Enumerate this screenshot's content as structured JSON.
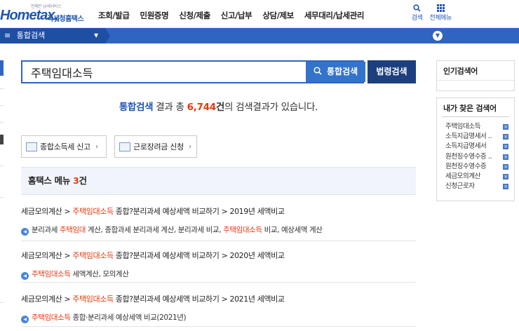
{
  "header": {
    "logo_tagline": "언제든 납세서비스",
    "logo_text": "Hometax,",
    "logo_sub": "국세청홈택스",
    "nav": [
      "조회/발급",
      "민원증명",
      "신청/제출",
      "신고/납부",
      "상담/제보",
      "세무대리/납세관리"
    ],
    "search_label": "검색",
    "all_menu_label": "전체메뉴"
  },
  "menubar": {
    "current": "통합검색"
  },
  "search": {
    "query": "주택임대소득",
    "search_button": "통합검색",
    "law_button": "법령검색"
  },
  "summary": {
    "prefix": "통합검색",
    "text1": "결과 총",
    "count": "6,744",
    "unit": "건",
    "text2": "의 검색결과가 있습니다."
  },
  "quick_links": [
    {
      "label": "종합소득세 신고"
    },
    {
      "label": "근로장려금 신청"
    }
  ],
  "menu_section": {
    "title": "홈택스 메뉴",
    "count": "3",
    "unit": "건"
  },
  "results": [
    {
      "path_prefix": "세금모의계산 > ",
      "path_hl": "주택임대소득",
      "path_suffix": " 종합?분리과세 예상세액 비교하기 > 2019년 세액비교",
      "desc": [
        {
          "t": "분리과세 ",
          "hl": false
        },
        {
          "t": "주택임대",
          "hl": true
        },
        {
          "t": " 계산, 종합과세 분리과세 계산, 분리과세 비교, ",
          "hl": false
        },
        {
          "t": "주택임대소득",
          "hl": true
        },
        {
          "t": " 비교, 예상세액 계산",
          "hl": false
        }
      ]
    },
    {
      "path_prefix": "세금모의계산 > ",
      "path_hl": "주택임대소득",
      "path_suffix": " 종합?분리과세 예상세액 비교하기 > 2020년 세액비교",
      "desc": [
        {
          "t": "주택임대소득",
          "hl": true
        },
        {
          "t": " 세액계산, 모의계산",
          "hl": false
        }
      ]
    },
    {
      "path_prefix": "세금모의계산 > ",
      "path_hl": "주택임대소득",
      "path_suffix": " 종합?분리과세 예상세액 비교하기 > 2021년 세액비교",
      "desc": [
        {
          "t": "주택임대소득",
          "hl": true
        },
        {
          "t": " 종합·분리과세 예상세액 비교(2021년)",
          "hl": false
        }
      ]
    }
  ],
  "sidebar": {
    "popular_title": "인기검색어",
    "mine_title": "내가 찾은 검색어",
    "my_searches": [
      "주택임대소득",
      "소득지급명세서 ..",
      "소득지급명세서",
      "원천징수영수증 ..",
      "원천징수영수증",
      "세금모의계산",
      "신청근로자"
    ]
  }
}
